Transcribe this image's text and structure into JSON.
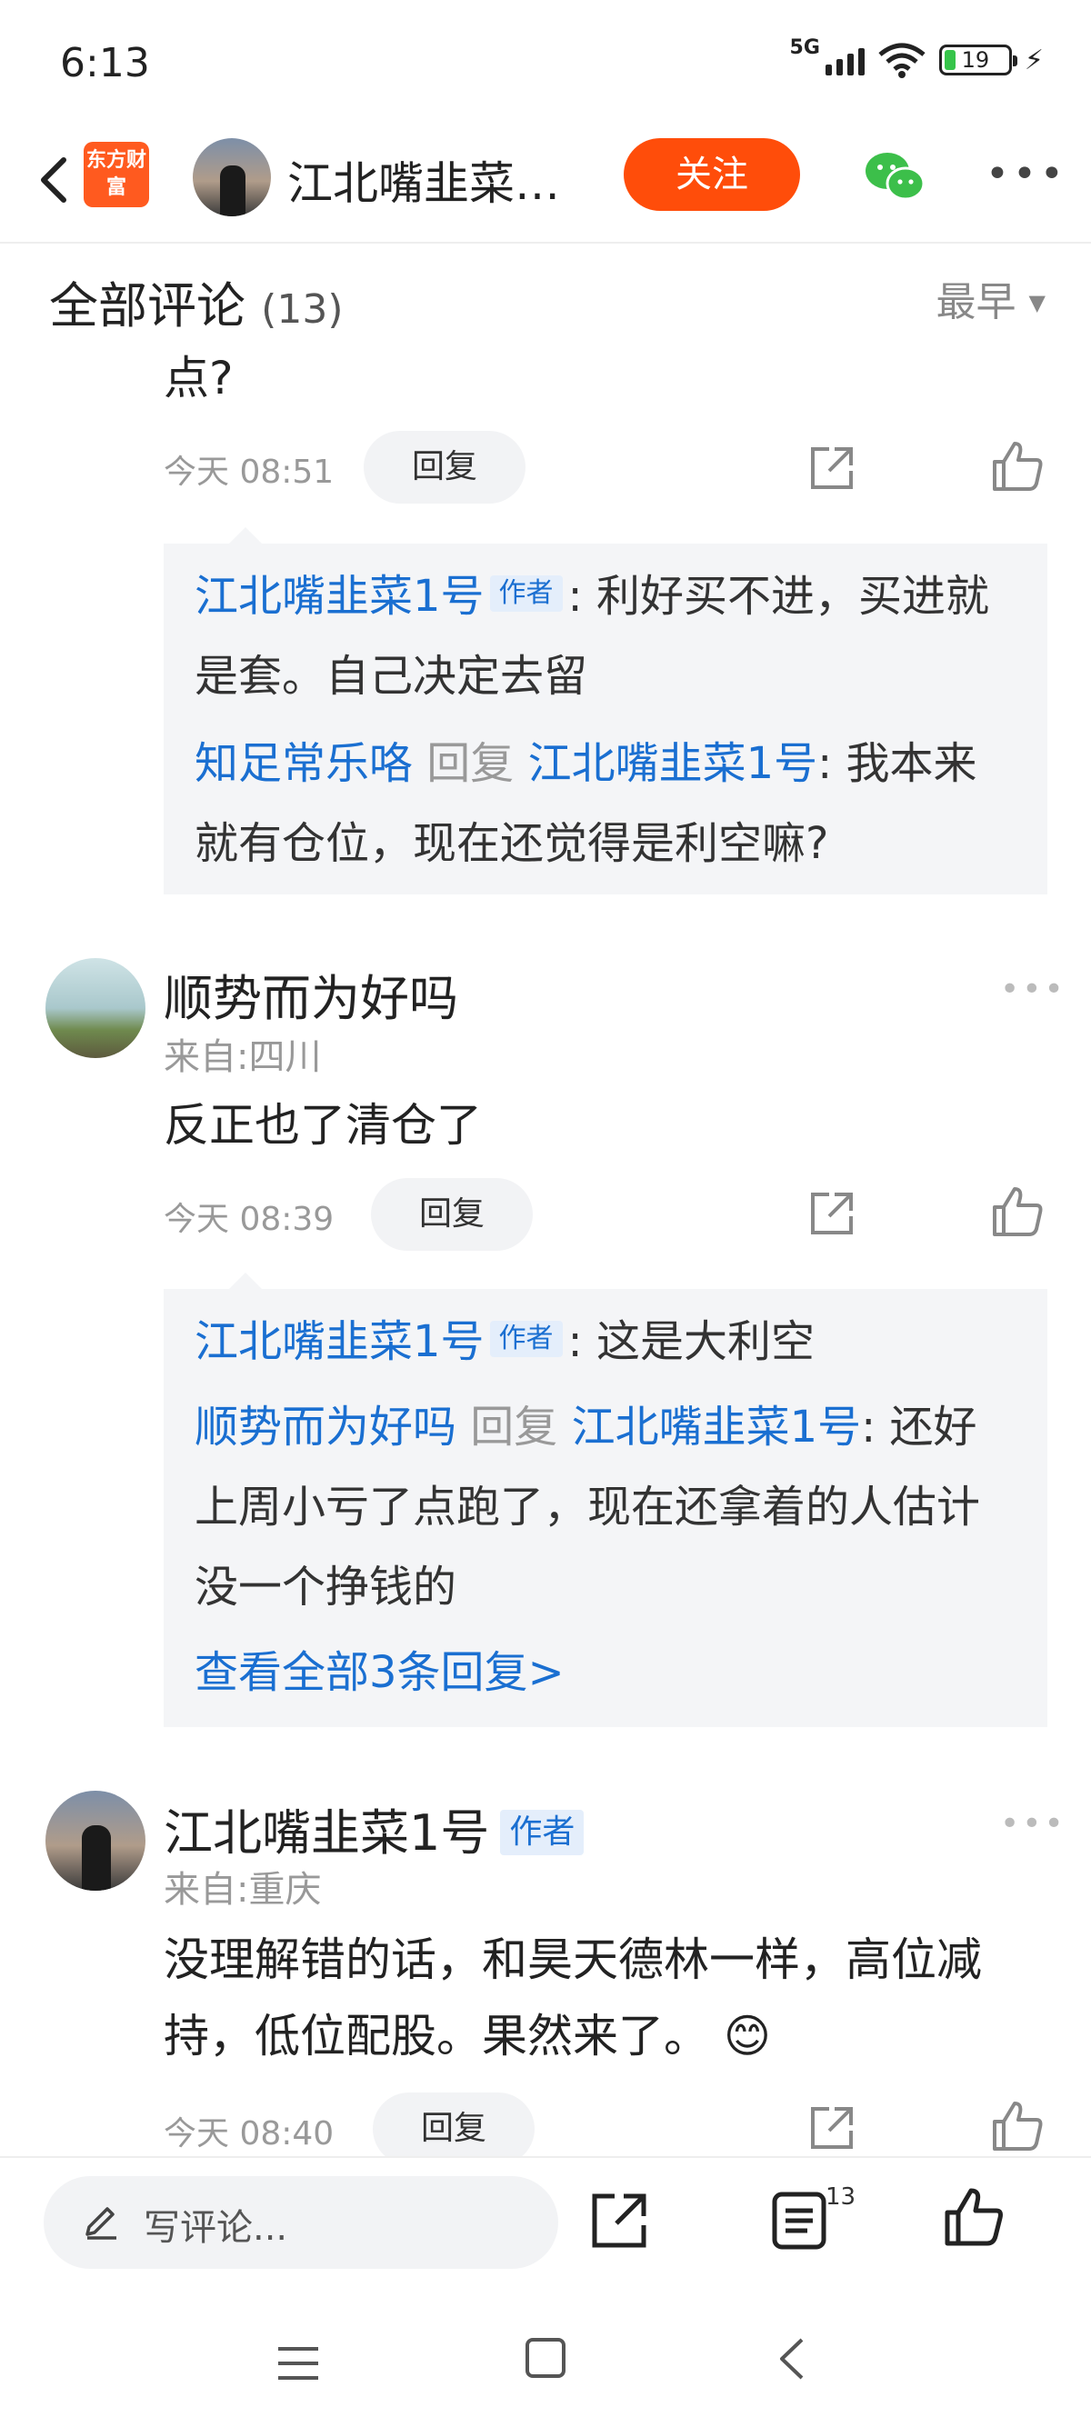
{
  "status": {
    "time": "6:13",
    "network": "5G",
    "battery": "19"
  },
  "nav": {
    "logo_text": "东方财富",
    "title": "江北嘴韭菜…",
    "follow_label": "关注"
  },
  "section": {
    "title": "全部评论",
    "count": "(13)",
    "sort_label": "最早"
  },
  "comment1": {
    "text_tail": "点?",
    "time": "今天 08:51",
    "reply_label": "回复",
    "replies": [
      {
        "name": "江北嘴韭菜1号",
        "tag": "作者",
        "content": ": 利好买不进，买进就是套。自己决定去留"
      },
      {
        "name": "知足常乐咯",
        "reply_word": "回复",
        "target": "江北嘴韭菜1号",
        "content": ": 我本来就有仓位，现在还觉得是利空嘛?"
      }
    ]
  },
  "comment2": {
    "name": "顺势而为好吗",
    "location": "来自:四川",
    "text": "反正也了清仓了",
    "time": "今天 08:39",
    "reply_label": "回复",
    "replies": [
      {
        "name": "江北嘴韭菜1号",
        "tag": "作者",
        "content": ": 这是大利空"
      },
      {
        "name": "顺势而为好吗",
        "reply_word": "回复",
        "target": "江北嘴韭菜1号",
        "content": ": 还好上周小亏了点跑了，现在还拿着的人估计没一个挣钱的"
      }
    ],
    "view_all": "查看全部3条回复>"
  },
  "comment3": {
    "name": "江北嘴韭菜1号",
    "tag": "作者",
    "location": "来自:重庆",
    "text": "没理解错的话，和昊天德林一样，高位减持，低位配股。果然来了。",
    "emoji": "😊",
    "time": "今天 08:40",
    "reply_label": "回复"
  },
  "bottom": {
    "placeholder": "写评论...",
    "comment_count": "13"
  },
  "icons": {
    "back": "back-arrow-icon",
    "wechat": "wechat-icon",
    "more": "more-icon",
    "share": "share-icon",
    "like": "like-icon",
    "pen": "pen-icon",
    "list": "comment-list-icon"
  },
  "colors": {
    "accent": "#ff4d0a",
    "link": "#1a6fd1",
    "logo": "#ff5a1f"
  }
}
